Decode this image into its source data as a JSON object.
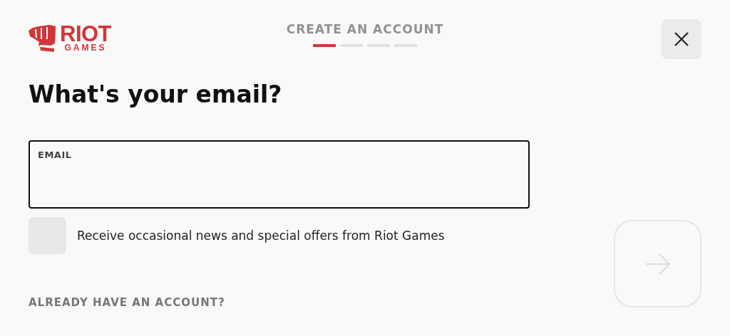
{
  "logo": {
    "line_1": "RIOT",
    "line_2": "GAMES"
  },
  "header": {
    "title": "CREATE AN ACCOUNT",
    "steps": [
      {
        "selected": true
      },
      {
        "selected": false
      },
      {
        "selected": false
      },
      {
        "selected": false
      }
    ]
  },
  "heading": "What's your email?",
  "email_field": {
    "label": "EMAIL"
  },
  "newsletter": {
    "label": "Receive occasional news and special offers from Riot Games",
    "checked": false
  },
  "next_button": {
    "disabled": true
  },
  "sign_in_link": "ALREADY HAVE AN ACCOUNT?"
}
